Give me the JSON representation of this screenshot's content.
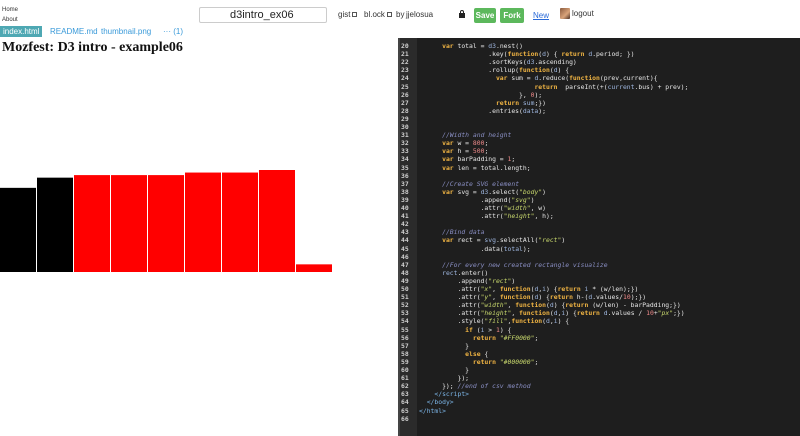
{
  "nav": {
    "home": "Home",
    "about": "About"
  },
  "gist": {
    "title": "d3intro_ex06"
  },
  "header": {
    "gist_link": "gist",
    "blocks_link": "bl.ock",
    "by_label": "by",
    "user": "jjelosua",
    "save_label": "Save",
    "fork_label": "Fork",
    "new_label": "New",
    "logout_label": "logout",
    "accent_color": "#5cb85c"
  },
  "tabs": [
    {
      "label": "index.html",
      "active": true
    },
    {
      "label": "README.md",
      "active": false
    },
    {
      "label": "thumbnail.png",
      "active": false
    },
    {
      "label": "··· (1)",
      "active": false
    }
  ],
  "preview": {
    "title": "Mozfest: D3 intro - example06",
    "bars": [
      {
        "value": 3.3,
        "color": "#000000"
      },
      {
        "value": 3.7,
        "color": "#000000"
      },
      {
        "value": 3.8,
        "color": "#ff0000"
      },
      {
        "value": 3.8,
        "color": "#ff0000"
      },
      {
        "value": 3.8,
        "color": "#ff0000"
      },
      {
        "value": 3.9,
        "color": "#ff0000"
      },
      {
        "value": 3.9,
        "color": "#ff0000"
      },
      {
        "value": 4.0,
        "color": "#ff0000"
      },
      {
        "value": 0.3,
        "color": "#ff0000"
      }
    ]
  },
  "code": {
    "lines": [
      {
        "n": "20",
        "html": "      <span class=\"kw\">var</span> total = <span class=\"vr\">d3</span>.nest()"
      },
      {
        "n": "21",
        "html": "                  .key(<span class=\"kw\">function</span>(<span class=\"vr\">d</span>) { <span class=\"kw\">return</span> <span class=\"vr\">d</span>.period; })"
      },
      {
        "n": "22",
        "html": "                  .sortKeys(<span class=\"vr\">d3</span>.ascending)"
      },
      {
        "n": "23",
        "html": "                  .rollup(<span class=\"kw\">function</span>(<span class=\"vr\">d</span>) {"
      },
      {
        "n": "24",
        "html": "                    <span class=\"kw\">var</span> sum = <span class=\"vr\">d</span>.reduce(<span class=\"kw\">function</span>(prev,current){"
      },
      {
        "n": "25",
        "html": "                              <span class=\"kw\">return</span>  parseInt(+(<span class=\"vr\">current</span>.bus) + prev);"
      },
      {
        "n": "26",
        "html": "                          }, <span class=\"num\">0</span>);"
      },
      {
        "n": "27",
        "html": "                    <span class=\"kw\">return</span> <span class=\"vr\">sum</span>;})"
      },
      {
        "n": "28",
        "html": "                  .entries(<span class=\"vr\">data</span>);"
      },
      {
        "n": "29",
        "html": ""
      },
      {
        "n": "30",
        "html": ""
      },
      {
        "n": "31",
        "html": "      <span class=\"cmt\">//Width and height</span>"
      },
      {
        "n": "32",
        "html": "      <span class=\"kw\">var</span> w = <span class=\"num\">800</span>;"
      },
      {
        "n": "33",
        "html": "      <span class=\"kw\">var</span> h = <span class=\"num\">500</span>;"
      },
      {
        "n": "34",
        "html": "      <span class=\"kw\">var</span> barPadding = <span class=\"num\">1</span>;"
      },
      {
        "n": "35",
        "html": "      <span class=\"kw\">var</span> len = total.length;"
      },
      {
        "n": "36",
        "html": ""
      },
      {
        "n": "37",
        "html": "      <span class=\"cmt\">//Create SVG element</span>"
      },
      {
        "n": "38",
        "html": "      <span class=\"kw\">var</span> svg = <span class=\"vr\">d3</span>.select(<span class=\"str\">\"body\"</span>)"
      },
      {
        "n": "39",
        "html": "                .append(<span class=\"str\">\"svg\"</span>)"
      },
      {
        "n": "40",
        "html": "                .attr(<span class=\"str\">\"width\"</span>, w)"
      },
      {
        "n": "41",
        "html": "                .attr(<span class=\"str\">\"height\"</span>, h);"
      },
      {
        "n": "42",
        "html": ""
      },
      {
        "n": "43",
        "html": "      <span class=\"cmt\">//Bind data</span>"
      },
      {
        "n": "44",
        "html": "      <span class=\"kw\">var</span> rect = <span class=\"vr\">svg</span>.selectAll(<span class=\"str\">\"rect\"</span>)"
      },
      {
        "n": "45",
        "html": "                .data(<span class=\"vr\">total</span>);"
      },
      {
        "n": "46",
        "html": ""
      },
      {
        "n": "47",
        "html": "      <span class=\"cmt\">//For every new created rectangle visualize</span>"
      },
      {
        "n": "48",
        "html": "      <span class=\"vr\">rect</span>.enter()"
      },
      {
        "n": "49",
        "html": "          .append(<span class=\"str\">\"rect\"</span>)"
      },
      {
        "n": "50",
        "html": "          .attr(<span class=\"str\">\"x\"</span>, <span class=\"kw\">function</span>(<span class=\"vr\">d</span>,<span class=\"vr\">i</span>) {<span class=\"kw\">return</span> <span class=\"vr\">i</span> * (w/len);})"
      },
      {
        "n": "51",
        "html": "          .attr(<span class=\"str\">\"y\"</span>, <span class=\"kw\">function</span>(<span class=\"vr\">d</span>) {<span class=\"kw\">return</span> h-(<span class=\"vr\">d</span>.values/<span class=\"num\">10</span>);})"
      },
      {
        "n": "52",
        "html": "          .attr(<span class=\"str\">\"width\"</span>, <span class=\"kw\">function</span>(<span class=\"vr\">d</span>) {<span class=\"kw\">return</span> (w/len) - barPadding;})"
      },
      {
        "n": "53",
        "html": "          .attr(<span class=\"str\">\"height\"</span>, <span class=\"kw\">function</span>(<span class=\"vr\">d</span>,<span class=\"vr\">i</span>) {<span class=\"kw\">return</span> <span class=\"vr\">d</span>.values / <span class=\"num\">10</span>+<span class=\"str\">\"px\"</span>;})"
      },
      {
        "n": "54",
        "html": "          .style(<span class=\"str\">\"fill\"</span>,<span class=\"kw\">function</span>(<span class=\"vr\">d</span>,<span class=\"vr\">i</span>) {"
      },
      {
        "n": "55",
        "html": "            <span class=\"kw\">if</span> (<span class=\"vr\">i</span> &gt; <span class=\"num\">1</span>) {"
      },
      {
        "n": "56",
        "html": "              <span class=\"kw\">return</span> <span class=\"str\">\"#FF0000\"</span>;"
      },
      {
        "n": "57",
        "html": "            }"
      },
      {
        "n": "58",
        "html": "            <span class=\"kw\">else</span> {"
      },
      {
        "n": "59",
        "html": "              <span class=\"kw\">return</span> <span class=\"str\">\"#000000\"</span>;"
      },
      {
        "n": "60",
        "html": "            }"
      },
      {
        "n": "61",
        "html": "          });"
      },
      {
        "n": "62",
        "html": "      }); <span class=\"cmt\">//end of csv method</span>"
      },
      {
        "n": "63",
        "html": "    <span class=\"tag\">&lt;/script&gt;</span>"
      },
      {
        "n": "64",
        "html": "  <span class=\"tag\">&lt;/body&gt;</span>"
      },
      {
        "n": "65",
        "html": "<span class=\"tag\">&lt;/html&gt;</span>"
      },
      {
        "n": "66",
        "html": ""
      }
    ]
  }
}
